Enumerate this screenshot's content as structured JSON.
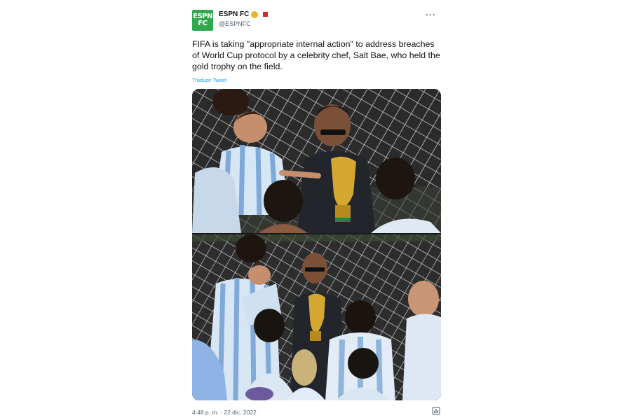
{
  "tweet": {
    "display_name": "ESPN FC",
    "handle": "@ESPNFC",
    "avatar_text_line1": "ESPN",
    "avatar_text_line2": "FC",
    "more_label": "···",
    "text": "FIFA is taking \"appropriate internal action\" to address breaches of World Cup protocol by a celebrity chef, Salt Bae, who held the gold trophy on the field.",
    "translate_label": "Traducir Tweet",
    "timestamp": "4:48 p. m. · 22 dic. 2022",
    "icons": {
      "verified": "verified-badge-icon",
      "affiliate": "affiliate-badge-icon",
      "analytics": "analytics-icon",
      "more": "more-icon"
    },
    "colors": {
      "avatar_bg": "#2fa84f",
      "link": "#1d9bf0",
      "verified": "#e8b923",
      "text": "#0f1419",
      "secondary": "#536471"
    }
  }
}
